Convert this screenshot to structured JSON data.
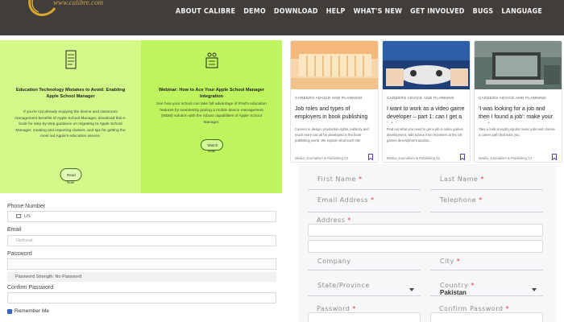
{
  "nav": {
    "logo_text": "www.calibre.com",
    "items": [
      "About Calibre",
      "Demo",
      "Download",
      "Help",
      "What's New",
      "Get Involved",
      "Bugs",
      "Language"
    ]
  },
  "promos": [
    {
      "icon": "book-icon",
      "title": "Education Technology Mistakes to Avoid: Enabling Apple School Manager",
      "body": "If you're not already enjoying the device and classroom management benefits of Apple School Manager, download this e-book for step-by-step guidance on migrating to Apple School Manager, creating and importing classes, and tips for getting the most out Apple's education service.",
      "button": "Read Now"
    },
    {
      "icon": "presentation-icon",
      "title": "Webinar: How to Ace Your Apple School Manager Integration",
      "body": "See how your school can take full advantage of iPad's education features by seamlessly pairing a mobile device management (MDM) solution with the robust capabilities of Apple School Manager.",
      "button": "Watch Now"
    }
  ],
  "articles": [
    {
      "category": "Careers advice and planning",
      "title": "Job roles and types of employers in book publishing",
      "desc": "Careers in design, production rights, publicity and much more can all be developed in the book publishing world. We explain what each role involves...",
      "meta": "Media, Journalism & Publishing 13",
      "image": "books-photo"
    },
    {
      "category": "Careers advice and planning",
      "title": "I want to work as a video game developer – part 1: can I get a job i...",
      "desc": "Find out what you need to get a job in video games development, with advice from recruiters at the UK games development studios...",
      "meta": "Media, Journalism & Publishing 13",
      "image": "gamepad-photo"
    },
    {
      "category": "Careers advice and planning",
      "title": "'I was looking for a job and then I found a job': make your mark on...",
      "desc": "Take a look at eight popular music jobs and choose a career path that suits you.",
      "meta": "Media, Journalism & Publishing 13",
      "image": "laptop-photo"
    }
  ],
  "left_form": {
    "phone_label": "Phone Number",
    "phone_value": "US",
    "email_label": "Email",
    "email_placeholder": "Optional",
    "password_label": "Password",
    "strength_text": "Password Strength: No Password",
    "confirm_label": "Confirm Password",
    "remember_label": "Remember Me"
  },
  "right_form": {
    "first_name": "First Name",
    "last_name": "Last Name",
    "email": "Email Address",
    "telephone": "Telephone",
    "address": "Address",
    "company": "Company",
    "city": "City",
    "state": "State/Province",
    "country": "Country",
    "country_value": "Pakistan",
    "password": "Password",
    "confirm_password": "Confirm Password",
    "required_mark": "*"
  },
  "colors": {
    "nav_bg": "#403d3b",
    "green_light": "#d2f98a",
    "green": "#bef55e",
    "required": "#e2324a",
    "checkbox": "#2f66c8"
  }
}
